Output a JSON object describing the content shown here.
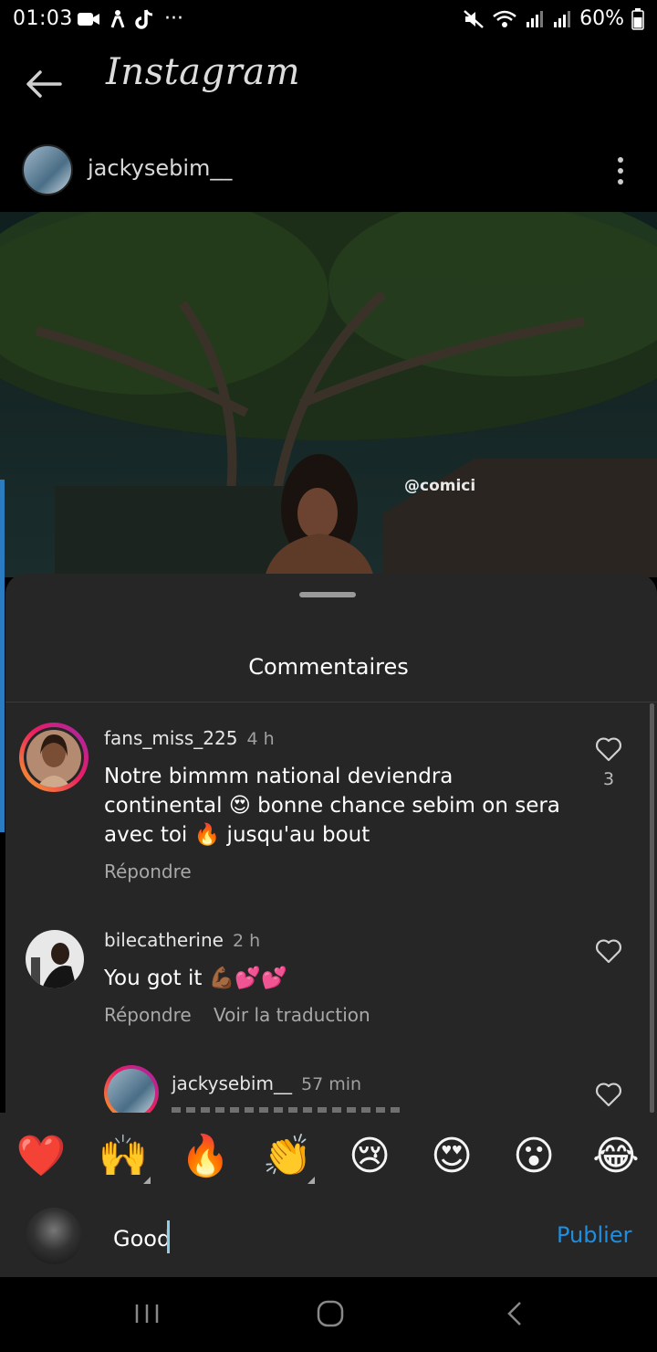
{
  "status_bar": {
    "time": "01:03",
    "notif_dots": "···",
    "battery": "60%"
  },
  "header": {
    "app_title": "Instagram",
    "post_username": "jackysebim__"
  },
  "photo": {
    "watermark": "@comici"
  },
  "sheet": {
    "title": "Commentaires"
  },
  "comments": [
    {
      "username": "fans_miss_225",
      "time": "4 h",
      "text_line1": "Notre bimmm national deviendra",
      "text_line2a": "continental ",
      "emoji_a": "😍",
      "text_line2b": " bonne chance sebim on sera",
      "text_line3a": "avec toi ",
      "emoji_b": "🔥",
      "text_line3b": " jusqu'au bout",
      "reply": "Répondre",
      "likes": "3"
    },
    {
      "username": "bilecatherine",
      "time": "2 h",
      "text": "You got it ",
      "emojis": "💪🏾💕💕",
      "reply": "Répondre",
      "translate": "Voir la traduction"
    },
    {
      "username": "jackysebim__",
      "time": "57 min"
    }
  ],
  "emoji_bar": [
    "❤️",
    "🙌",
    "🔥",
    "👏",
    "😢",
    "😍",
    "😮",
    "😂"
  ],
  "input": {
    "value": "Good",
    "publish_label": "Publier"
  },
  "colors": {
    "accent": "#1d8fe0",
    "sheet_bg": "#262626"
  }
}
